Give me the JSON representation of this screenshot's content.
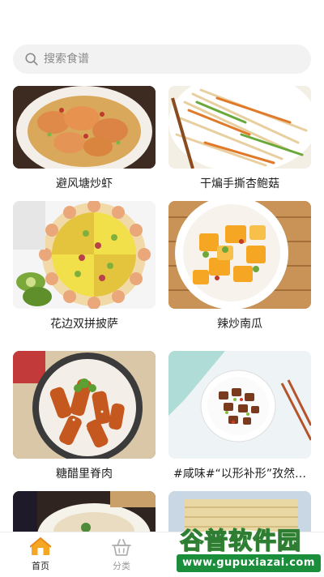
{
  "search": {
    "placeholder": "搜索食谱",
    "icon": "search-icon"
  },
  "recipes": [
    {
      "title": "避风塘炒虾"
    },
    {
      "title": "干煸手撕杏鲍菇"
    },
    {
      "title": "花边双拼披萨"
    },
    {
      "title": "辣炒南瓜"
    },
    {
      "title": "糖醋里脊肉"
    },
    {
      "title": "#咸味#“以形补形”孜然…"
    },
    {
      "title": ""
    },
    {
      "title": ""
    }
  ],
  "tabbar": {
    "home": {
      "label": "首页",
      "icon": "home-icon",
      "color": "#f5a623"
    },
    "category": {
      "label": "分类",
      "icon": "basket-icon"
    }
  },
  "watermark": {
    "top": "谷普软件园",
    "bottom": "www.gupuxiazai.com"
  }
}
